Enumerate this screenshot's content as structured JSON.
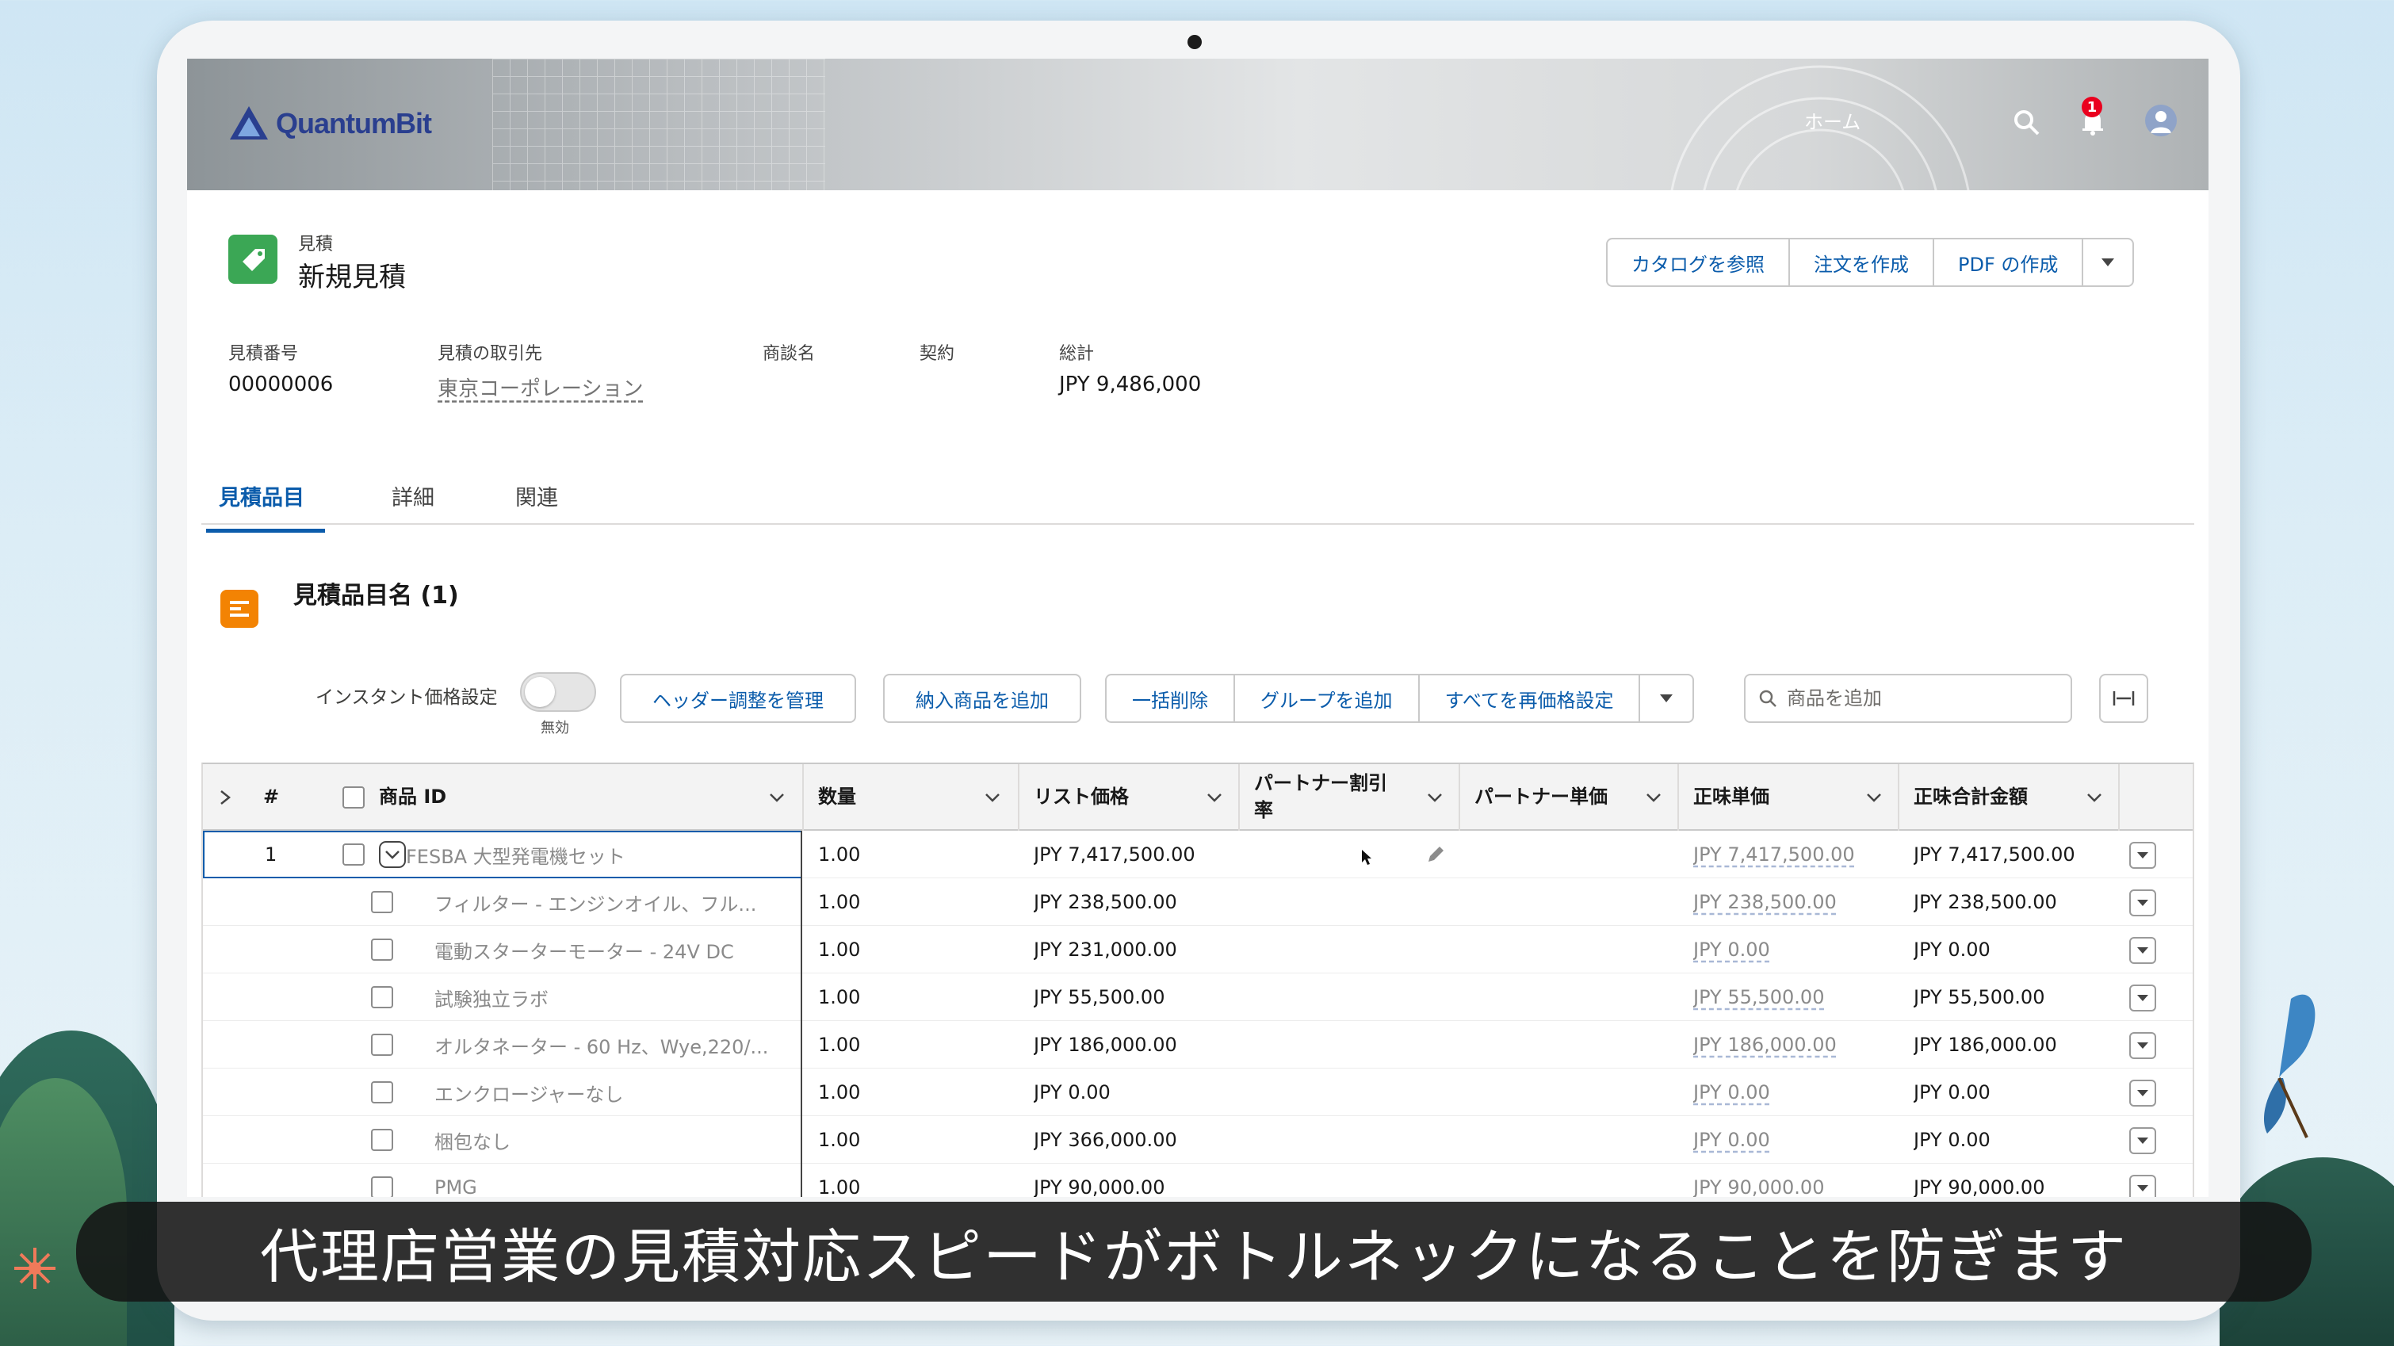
{
  "colors": {
    "accent": "#0b5cab",
    "record_icon": "#3ba755",
    "list_icon": "#f38303",
    "badge": "#ea001e"
  },
  "header": {
    "logo_text": "QuantumBit",
    "nav_home": "ホーム",
    "notification_count": "1",
    "icons": [
      "search-icon",
      "bell-icon",
      "user-avatar-icon"
    ]
  },
  "record": {
    "type_label": "見積",
    "title": "新規見積",
    "actions": [
      "カタログを参照",
      "注文を作成",
      "PDF の作成"
    ],
    "fields": [
      {
        "label": "見積番号",
        "value": "00000006"
      },
      {
        "label": "見積の取引先",
        "value": "東京コーポレーション"
      },
      {
        "label": "商談名",
        "value": ""
      },
      {
        "label": "契約",
        "value": ""
      },
      {
        "label": "総計",
        "value": "JPY 9,486,000"
      }
    ]
  },
  "tabs": [
    {
      "label": "見積品目",
      "active": true
    },
    {
      "label": "詳細",
      "active": false
    },
    {
      "label": "関連",
      "active": false
    }
  ],
  "line_items": {
    "title": "見積品目名 (1)",
    "toggle_label": "インスタント価格設定",
    "toggle_state": "無効",
    "buttons": {
      "manage_header": "ヘッダー調整を管理",
      "add_delivered": "納入商品を追加",
      "bulk_delete": "一括削除",
      "add_group": "グループを追加",
      "reprice_all": "すべてを再価格設定"
    },
    "search_placeholder": "商品を追加",
    "columns": [
      "#",
      "商品 ID",
      "数量",
      "リスト価格",
      "パートナー割引率",
      "パートナー単価",
      "正味単価",
      "正味合計金額"
    ],
    "rows": [
      {
        "num": "1",
        "name": "FESBA 大型発電機セット",
        "qty": "1.00",
        "list": "JPY 7,417,500.00",
        "disc": "",
        "partner": "",
        "net_unit": "JPY 7,417,500.00",
        "net_total": "JPY 7,417,500.00"
      },
      {
        "num": "",
        "name": "フィルター - エンジンオイル、フル...",
        "qty": "1.00",
        "list": "JPY 238,500.00",
        "disc": "",
        "partner": "",
        "net_unit": "JPY 238,500.00",
        "net_total": "JPY 238,500.00"
      },
      {
        "num": "",
        "name": "電動スターターモーター - 24V DC",
        "qty": "1.00",
        "list": "JPY 231,000.00",
        "disc": "",
        "partner": "",
        "net_unit": "JPY 0.00",
        "net_total": "JPY 0.00"
      },
      {
        "num": "",
        "name": "試験独立ラボ",
        "qty": "1.00",
        "list": "JPY 55,500.00",
        "disc": "",
        "partner": "",
        "net_unit": "JPY 55,500.00",
        "net_total": "JPY 55,500.00"
      },
      {
        "num": "",
        "name": "オルタネーター - 60 Hz、Wye,220/...",
        "qty": "1.00",
        "list": "JPY 186,000.00",
        "disc": "",
        "partner": "",
        "net_unit": "JPY 186,000.00",
        "net_total": "JPY 186,000.00"
      },
      {
        "num": "",
        "name": "エンクロージャーなし",
        "qty": "1.00",
        "list": "JPY 0.00",
        "disc": "",
        "partner": "",
        "net_unit": "JPY 0.00",
        "net_total": "JPY 0.00"
      },
      {
        "num": "",
        "name": "梱包なし",
        "qty": "1.00",
        "list": "JPY 366,000.00",
        "disc": "",
        "partner": "",
        "net_unit": "JPY 0.00",
        "net_total": "JPY 0.00"
      },
      {
        "num": "",
        "name": "PMG",
        "qty": "1.00",
        "list": "JPY 90,000.00",
        "disc": "",
        "partner": "",
        "net_unit": "JPY 90,000.00",
        "net_total": "JPY 90,000.00"
      }
    ]
  },
  "caption": "代理店営業の見積対応スピードがボトルネックになることを防ぎます"
}
